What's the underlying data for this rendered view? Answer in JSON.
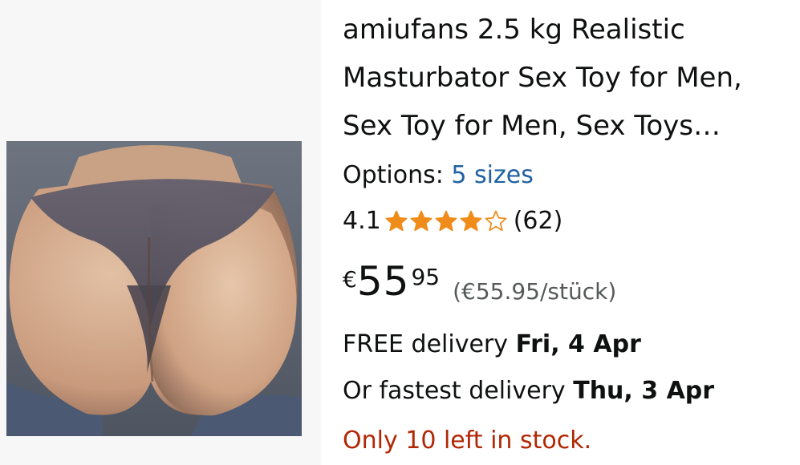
{
  "product": {
    "title": "amiufans 2.5 kg Realistic Masturbator Sex Toy for Men, Sex Toy for Men, Sex Toys…",
    "image_alt": "product photo",
    "options_label": "Options:",
    "options_link": "5 sizes",
    "rating_value": "4.1",
    "rating_stars": 4.1,
    "rating_max": 5,
    "rating_count": "(62)",
    "price_symbol": "€",
    "price_whole": "55",
    "price_fraction": "95",
    "unit_price": "(€55.95/stück)",
    "delivery_label": "FREE delivery",
    "delivery_date": "Fri, 4 Apr",
    "fastest_label": "Or fastest delivery",
    "fastest_date": "Thu, 3 Apr",
    "stock_text": "Only 10 left in stock."
  },
  "colors": {
    "link": "#2162a1",
    "star": "#f08c1a",
    "stock_warning": "#b12704",
    "secondary_text": "#565959"
  }
}
